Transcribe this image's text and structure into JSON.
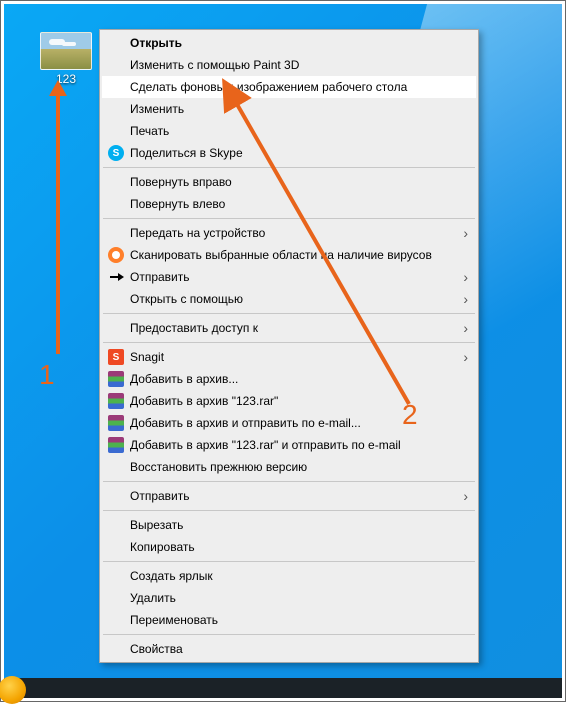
{
  "desktop": {
    "icon_label": "123"
  },
  "menu": {
    "items": [
      {
        "label": "Открыть",
        "bold": true
      },
      {
        "label": "Изменить с помощью Paint 3D"
      },
      {
        "label": "Сделать фоновым изображением рабочего стола",
        "highlight": true
      },
      {
        "label": "Изменить"
      },
      {
        "label": "Печать"
      },
      {
        "label": "Поделиться в Skype",
        "icon": "skype"
      },
      {
        "sep": true
      },
      {
        "label": "Повернуть вправо"
      },
      {
        "label": "Повернуть влево"
      },
      {
        "sep": true
      },
      {
        "label": "Передать на устройство",
        "submenu": true
      },
      {
        "label": "Сканировать выбранные области на наличие вирусов",
        "icon": "avast"
      },
      {
        "label": "Отправить",
        "icon": "share",
        "submenu": true
      },
      {
        "label": "Открыть с помощью",
        "submenu": true
      },
      {
        "sep": true
      },
      {
        "label": "Предоставить доступ к",
        "submenu": true
      },
      {
        "sep": true
      },
      {
        "label": "Snagit",
        "icon": "snagit",
        "submenu": true
      },
      {
        "label": "Добавить в архив...",
        "icon": "rar"
      },
      {
        "label": "Добавить в архив \"123.rar\"",
        "icon": "rar"
      },
      {
        "label": "Добавить в архив и отправить по e-mail...",
        "icon": "rar"
      },
      {
        "label": "Добавить в архив \"123.rar\" и отправить по e-mail",
        "icon": "rar"
      },
      {
        "label": "Восстановить прежнюю версию"
      },
      {
        "sep": true
      },
      {
        "label": "Отправить",
        "submenu": true
      },
      {
        "sep": true
      },
      {
        "label": "Вырезать"
      },
      {
        "label": "Копировать"
      },
      {
        "sep": true
      },
      {
        "label": "Создать ярлык"
      },
      {
        "label": "Удалить"
      },
      {
        "label": "Переименовать"
      },
      {
        "sep": true
      },
      {
        "label": "Свойства"
      }
    ]
  },
  "annotations": {
    "label1": "1",
    "label2": "2",
    "color": "#e8641b"
  }
}
